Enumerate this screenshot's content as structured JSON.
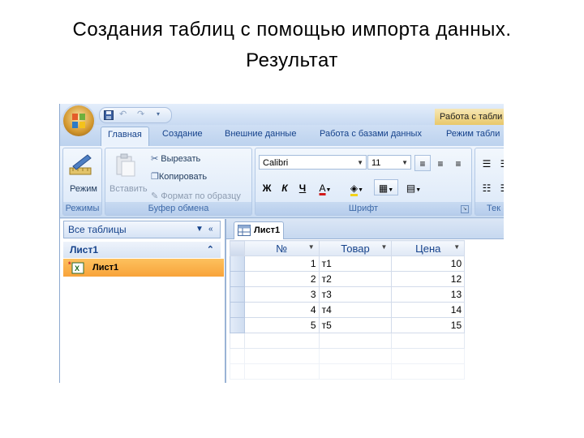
{
  "slide": {
    "title_line1": "Создания таблиц с помощью импорта данных.",
    "title_line2": "Результат"
  },
  "window": {
    "context_title": "Работа с табли"
  },
  "ribbon": {
    "tabs": [
      "Главная",
      "Создание",
      "Внешние данные",
      "Работа с базами данных",
      "Режим табли"
    ],
    "active_tab": "Главная",
    "groups": {
      "views": {
        "label": "Режимы",
        "button": "Режим"
      },
      "clipboard": {
        "label": "Буфер обмена",
        "paste": "Вставить",
        "cut": "Вырезать",
        "copy": "Копировать",
        "format_painter": "Формат по образцу"
      },
      "font": {
        "label": "Шрифт",
        "font_name": "Calibri",
        "font_size": "11",
        "bold": "Ж",
        "italic": "К",
        "underline": "Ч",
        "font_color_letter": "А"
      },
      "text": {
        "label": "Тек"
      }
    }
  },
  "nav_pane": {
    "header": "Все таблицы",
    "group": "Лист1",
    "item": "Лист1"
  },
  "document": {
    "tab": "Лист1",
    "columns": [
      "№",
      "Товар",
      "Цена"
    ],
    "rows": [
      {
        "num": "1",
        "item": "т1",
        "price": "10"
      },
      {
        "num": "2",
        "item": "т2",
        "price": "12"
      },
      {
        "num": "3",
        "item": "т3",
        "price": "13"
      },
      {
        "num": "4",
        "item": "т4",
        "price": "14"
      },
      {
        "num": "5",
        "item": "т5",
        "price": "15"
      }
    ]
  },
  "icons": [
    "office-button-icon",
    "save-icon",
    "undo-icon",
    "redo-icon",
    "view-mode-icon",
    "paste-icon",
    "cut-icon",
    "copy-icon",
    "format-painter-icon",
    "table-icon",
    "sort-arrow-icon"
  ],
  "colors": {
    "accent": "#15428b",
    "selected_item": "#f8a33a",
    "ribbon": "#d7e6f8"
  }
}
